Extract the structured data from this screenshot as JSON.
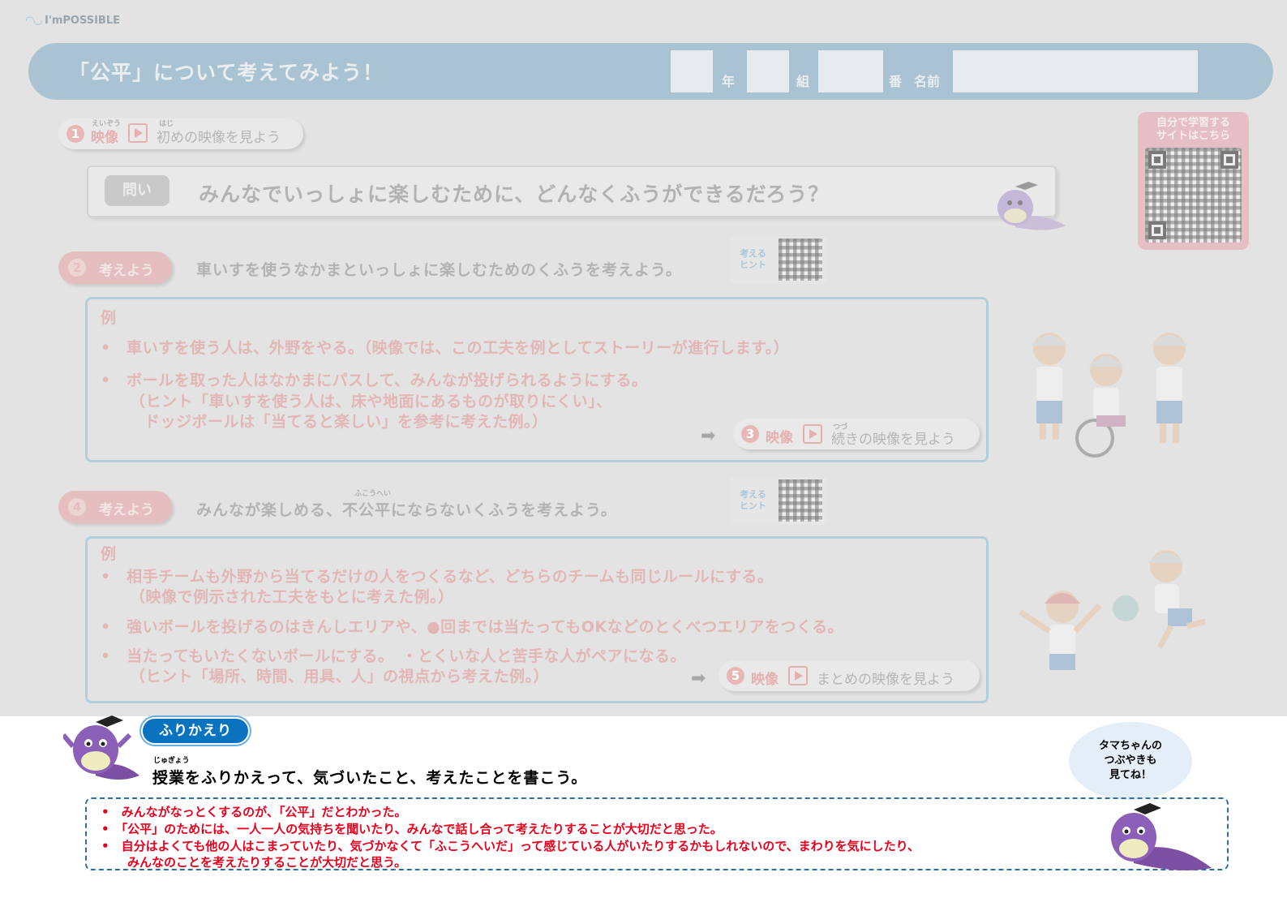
{
  "logo": {
    "text": "I'mPOSSIBLE"
  },
  "header": {
    "title": "「公平」について考えてみよう！",
    "year_label": "年",
    "class_label": "組",
    "number_label": "番",
    "name_label": "名前"
  },
  "self_study": {
    "label_line1": "自分で学習する",
    "label_line2": "サイトはこちら"
  },
  "step1": {
    "number": "1",
    "label": "映像",
    "label_ruby": "えいぞう",
    "text": "初めの映像を見よう",
    "text_ruby": "はじ"
  },
  "question": {
    "tag": "問い",
    "text": "みんなでいっしょに楽しむために、どんなくふうができるだろう？"
  },
  "step2": {
    "number": "2",
    "label": "考えよう",
    "prompt": "車いすを使うなかまといっしょに楽しむためのくふうを考えよう。",
    "hint_line1": "考える",
    "hint_line2": "ヒント",
    "example_head": "例",
    "examples": [
      "•　車いすを使う人は、外野をやる。（映像では、この工夫を例としてストーリーが進行します。）",
      "•　ボールを取った人はなかまにパスして、みんなが投げられるようにする。"
    ],
    "example_sub1": "（ヒント「車いすを使う人は、床や地面にあるものが取りにくい」、",
    "example_sub2": "ドッジボールは「当てると楽しい」を参考に考えた例。）"
  },
  "step3": {
    "number": "3",
    "label": "映像",
    "text": "続きの映像を見よう",
    "text_ruby": "つづ"
  },
  "step4": {
    "number": "4",
    "label": "考えよう",
    "prompt": "みんなが楽しめる、不公平にならないくふうを考えよう。",
    "prompt_ruby": "ふこうへい",
    "hint_line1": "考える",
    "hint_line2": "ヒント",
    "example_head": "例",
    "example1": "•　相手チームも外野から当てるだけの人をつくるなど、どちらのチームも同じルールにする。",
    "example1_sub": "（映像で例示された工夫をもとに考えた例。）",
    "example2": "•　強いボールを投げるのはきんしエリアや、●回までは当たってもOKなどのとくべつエリアをつくる。",
    "example3": "•　当たってもいたくないボールにする。　・とくいな人と苦手な人がペアになる。",
    "example3_sub": "（ヒント「場所、時間、用具、人」の視点から考えた例。）"
  },
  "step5": {
    "number": "5",
    "label": "映像",
    "text": "まとめの映像を見よう"
  },
  "review": {
    "tag": "ふりかえり",
    "prompt_ruby": "じゅぎょう",
    "prompt": "授業をふりかえって、気づいたこと、考えたことを書こう。",
    "answers": [
      "•　みんながなっとくするのが、「公平」だとわかった。",
      "•　「公平」のためには、一人一人の気持ちを聞いたり、みんなで話し合って考えたりすることが大切だと思った。",
      "•　自分はよくても他の人はこまっていたり、気づかなくて「ふこうへいだ」って感じている人がいたりするかもしれないので、まわりを気にしたり、"
    ],
    "answer_continuation": "みんなのことを考えたりすることが大切だと思う。"
  },
  "bubble": {
    "line1": "タマちゃんの",
    "line2": "つぶやきも",
    "line3": "見てね！"
  },
  "colors": {
    "accent_blue": "#0a73c0",
    "answer_red": "#e8001c",
    "header_bar": "#a9c3d2",
    "example_pink": "#e3b6b6"
  },
  "icons": [
    "play-icon",
    "arrow-right-icon",
    "qr-code-icon",
    "mascot-tama-icon"
  ]
}
